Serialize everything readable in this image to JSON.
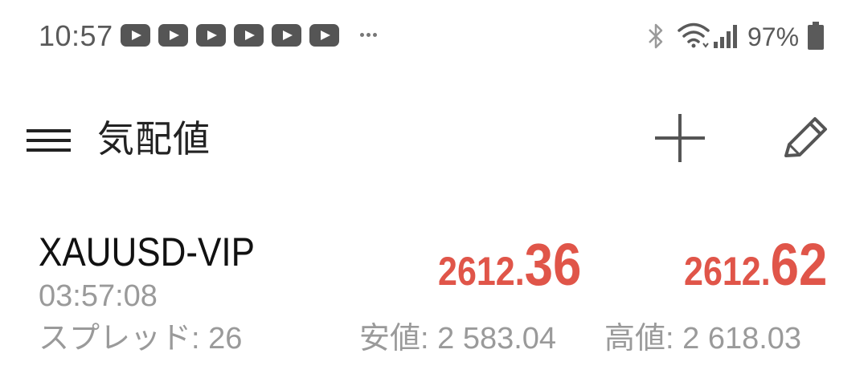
{
  "status_bar": {
    "time": "10:57",
    "notification_icons": [
      "youtube-icon",
      "youtube-icon",
      "youtube-icon",
      "youtube-icon",
      "youtube-icon",
      "youtube-icon"
    ],
    "battery": "97%"
  },
  "app_bar": {
    "title": "気配値"
  },
  "quote": {
    "symbol": "XAUUSD-VIP",
    "time": "03:57:08",
    "spread_label": "スプレッド",
    "spread_value": "26",
    "bid_main": "2612.",
    "bid_pips": "36",
    "ask_main": "2612.",
    "ask_pips": "62",
    "low_label": "安値",
    "low_value": "2 583.04",
    "high_label": "高値",
    "high_value": "2 618.03"
  },
  "colors": {
    "price": "#e05549",
    "secondary_text": "#9a9a9a",
    "icon": "#555555"
  }
}
